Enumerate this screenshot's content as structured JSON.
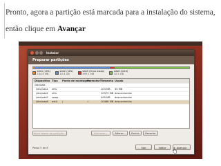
{
  "caption": {
    "text": "Pronto, agora a partição está marcada para a instalação do sistema, então clique em",
    "emphasis": "Avançar"
  },
  "window": {
    "title": "Instalar",
    "header": "Preparar partições"
  },
  "partition_bar": [
    {
      "label": "sda1 (ntfs)",
      "size": "104.9 MB",
      "color": "#e98a2c",
      "fraction": 0.01
    },
    {
      "label": "sda2 (ntfs)",
      "size": "10.4 GB",
      "color": "#5c8dd6",
      "fraction": 0.48
    },
    {
      "label": "sda5 (linux-swap)",
      "size": "499.1 MB",
      "color": "#cf3b3b",
      "fraction": 0.03
    },
    {
      "label": "sda6 (ext4)",
      "size": "10.5 GB",
      "color": "#7fc046",
      "fraction": 0.48
    }
  ],
  "table": {
    "columns": [
      "Dispositivo",
      "Tipo",
      "Ponto de montagem",
      "Formatar?",
      "Tamanho",
      "Usado"
    ],
    "rows": [
      {
        "device": "/dev/sda",
        "type": "",
        "mount": "",
        "format": "",
        "size": "",
        "used": "",
        "selected": false
      },
      {
        "device": "/dev/sda1",
        "type": "ntfs",
        "mount": "",
        "format": "",
        "size": "104 MB",
        "used": "35 MB",
        "selected": false
      },
      {
        "device": "/dev/sda2",
        "type": "ntfs",
        "mount": "",
        "format": "",
        "size": "10379 MB",
        "used": "desconhecido",
        "selected": false
      },
      {
        "device": "/dev/sda5",
        "type": "swap",
        "mount": "",
        "format": "",
        "size": "499 MB",
        "used": "desconhecido",
        "selected": false
      },
      {
        "device": "/dev/sda6",
        "type": "ext4",
        "mount": "/",
        "format": "✓",
        "size": "10486 MB",
        "used": "desconhecido",
        "selected": true
      }
    ]
  },
  "buttons": {
    "new_table": "Nova tabela de partição...",
    "add": "Adicionar...",
    "change": "Alterar...",
    "delete": "Excluir",
    "revert": "Reverter"
  },
  "footer": {
    "step": "Passo 5 de 8",
    "quit": "Sair",
    "back": "Voltar",
    "forward": "Avançar"
  }
}
